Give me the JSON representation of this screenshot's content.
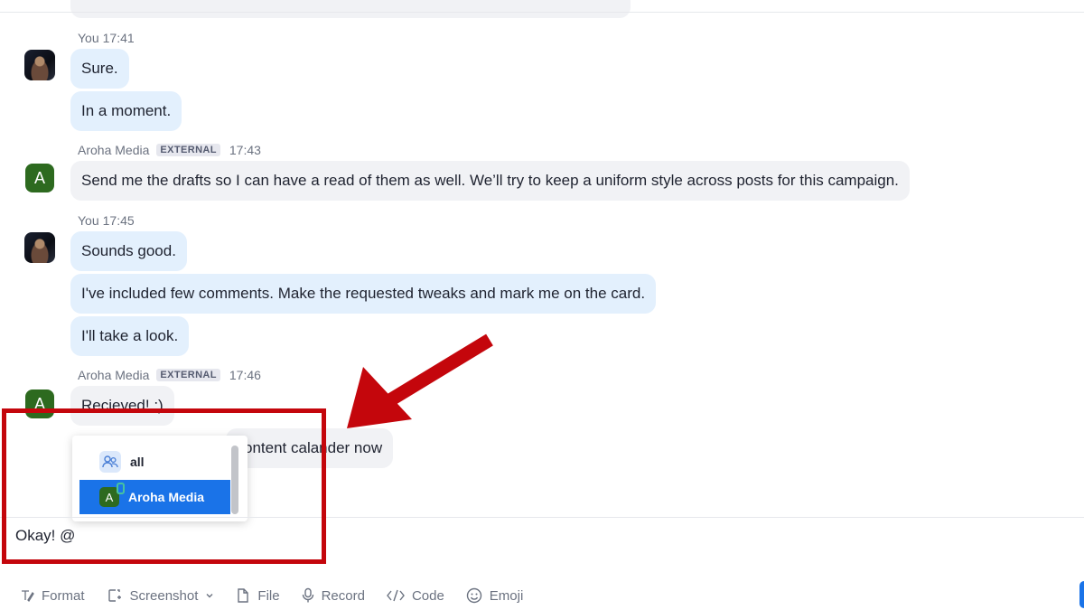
{
  "messages": [
    {
      "author": "You",
      "time": "17:41",
      "lines": [
        "Sure.",
        "In a moment."
      ]
    },
    {
      "author": "Aroha Media",
      "badge": "EXTERNAL",
      "time": "17:43",
      "avatar_letter": "A",
      "lines": [
        "Send me the drafts so I can have a read of them as well. We’ll try to keep a uniform style across posts for this campaign."
      ]
    },
    {
      "author": "You",
      "time": "17:45",
      "lines": [
        "Sounds good.",
        "I've included few comments. Make the requested tweaks and mark me on the card.",
        "I'll take a look."
      ]
    },
    {
      "author": "Aroha Media",
      "badge": "EXTERNAL",
      "time": "17:46",
      "avatar_letter": "A",
      "lines": [
        "Recieved! :)",
        "ontent calander now"
      ]
    }
  ],
  "mention_popup": {
    "items": [
      {
        "label": "all",
        "icon": "people-icon"
      },
      {
        "label": "Aroha Media",
        "avatar_letter": "A",
        "selected": true
      }
    ]
  },
  "composer": {
    "text": "Okay! @",
    "toolbar": {
      "format": "Format",
      "screenshot": "Screenshot",
      "file": "File",
      "record": "Record",
      "code": "Code",
      "emoji": "Emoji"
    }
  },
  "colors": {
    "accent": "#1a73e8",
    "my_bubble": "#e3f0fd",
    "their_bubble": "#f1f2f5",
    "avatar_green": "#2d6a1f",
    "annotation_red": "#c4060c"
  }
}
